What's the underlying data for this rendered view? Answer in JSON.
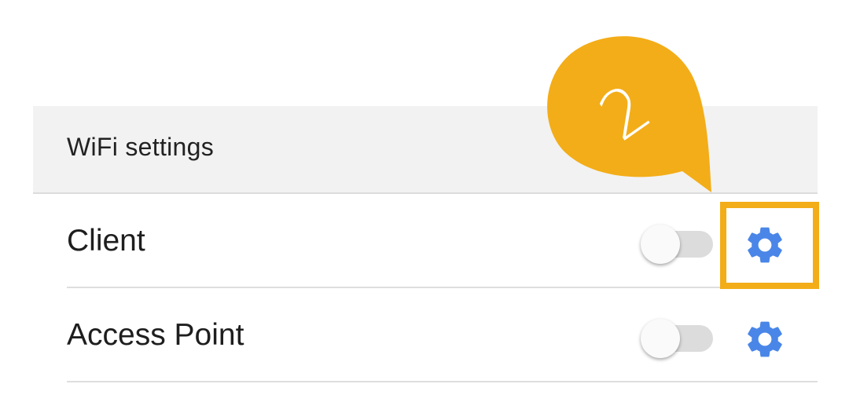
{
  "section": {
    "title": "WiFi settings"
  },
  "rows": [
    {
      "label": "Client",
      "toggle_on": false,
      "settings_icon": "gear-icon"
    },
    {
      "label": "Access Point",
      "toggle_on": false,
      "settings_icon": "gear-icon"
    }
  ],
  "callout": {
    "number": "2"
  },
  "colors": {
    "accent_blue": "#4a86e8",
    "callout_yellow": "#f3ad18",
    "header_bg": "#f2f2f2"
  }
}
